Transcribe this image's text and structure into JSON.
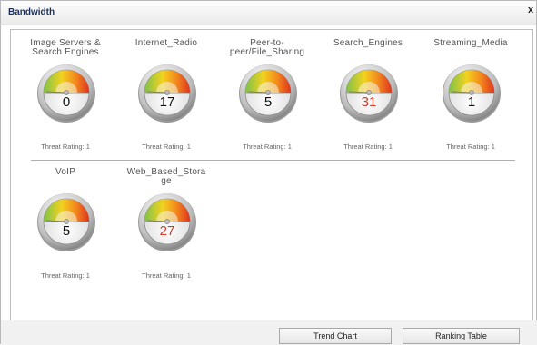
{
  "window": {
    "title": "Bandwidth",
    "close_label": "x"
  },
  "gauges": [
    {
      "label_lines": [
        "Image Servers &",
        "Search Engines"
      ],
      "value": "0",
      "rating": "Threat Rating: 1",
      "value_color": "#111111"
    },
    {
      "label_lines": [
        "Internet_Radio"
      ],
      "value": "17",
      "rating": "Threat Rating: 1",
      "value_color": "#111111"
    },
    {
      "label_lines": [
        "Peer-to-",
        "peer/File_Sharing"
      ],
      "value": "5",
      "rating": "Threat Rating: 1",
      "value_color": "#111111"
    },
    {
      "label_lines": [
        "Search_Engines"
      ],
      "value": "31",
      "rating": "Threat Rating: 1",
      "value_color": "#d43a2a"
    },
    {
      "label_lines": [
        "Streaming_Media"
      ],
      "value": "1",
      "rating": "Threat Rating: 1",
      "value_color": "#111111"
    },
    {
      "label_lines": [
        "VoIP"
      ],
      "value": "5",
      "rating": "Threat Rating: 1",
      "value_color": "#111111"
    },
    {
      "label_lines": [
        "Web_Based_Stora",
        "ge"
      ],
      "value": "27",
      "rating": "Threat Rating: 1",
      "value_color": "#d43a2a"
    }
  ],
  "buttons": {
    "trend_chart": "Trend Chart",
    "ranking_table": "Ranking Table"
  }
}
